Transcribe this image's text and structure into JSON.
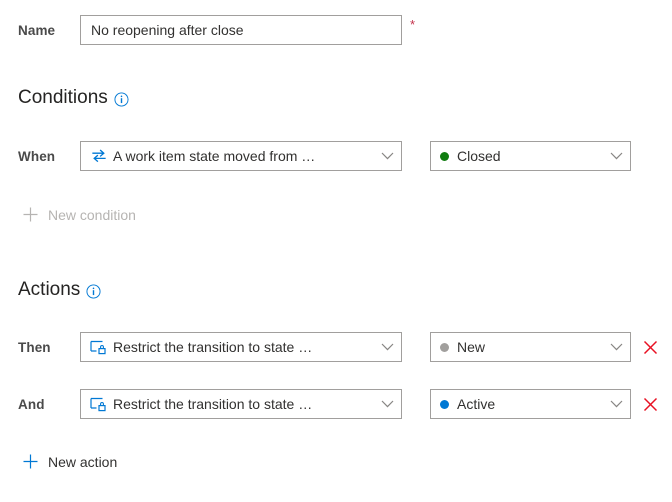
{
  "form": {
    "name_field": {
      "label": "Name",
      "value": "No reopening after close",
      "placeholder": "",
      "required_marker": "*"
    }
  },
  "conditions": {
    "header": "Conditions",
    "info_icon": "info-icon",
    "rows": [
      {
        "label": "When",
        "rule": {
          "icon": "transition-arrows-icon",
          "text": "A work item state moved from …"
        },
        "state": {
          "label": "Closed",
          "dot_color": "#107c10"
        },
        "chevron": "chevron-down-icon"
      }
    ],
    "add_link": {
      "label": "New condition",
      "icon": "plus-icon",
      "enabled": false
    }
  },
  "actions": {
    "header": "Actions",
    "info_icon": "info-icon",
    "rows": [
      {
        "label": "Then",
        "rule": {
          "icon": "restrict-transition-lock-icon",
          "text": "Restrict the transition to state …"
        },
        "state": {
          "label": "New",
          "dot_color": "#a19f9d"
        },
        "chevron": "chevron-down-icon",
        "delete_icon": "close-x-icon"
      },
      {
        "label": "And",
        "rule": {
          "icon": "restrict-transition-lock-icon",
          "text": "Restrict the transition to state …"
        },
        "state": {
          "label": "Active",
          "dot_color": "#0078d4"
        },
        "chevron": "chevron-down-icon",
        "delete_icon": "close-x-icon"
      }
    ],
    "add_link": {
      "label": "New action",
      "icon": "plus-icon",
      "enabled": true
    }
  },
  "colors": {
    "accent": "#0078d4",
    "border": "#a19f9d",
    "text": "#323130",
    "disabled_text": "#b6b4b2",
    "required": "#c4314b",
    "delete": "#e81123",
    "state_closed": "#107c10",
    "state_new": "#a19f9d",
    "state_active": "#0078d4"
  }
}
